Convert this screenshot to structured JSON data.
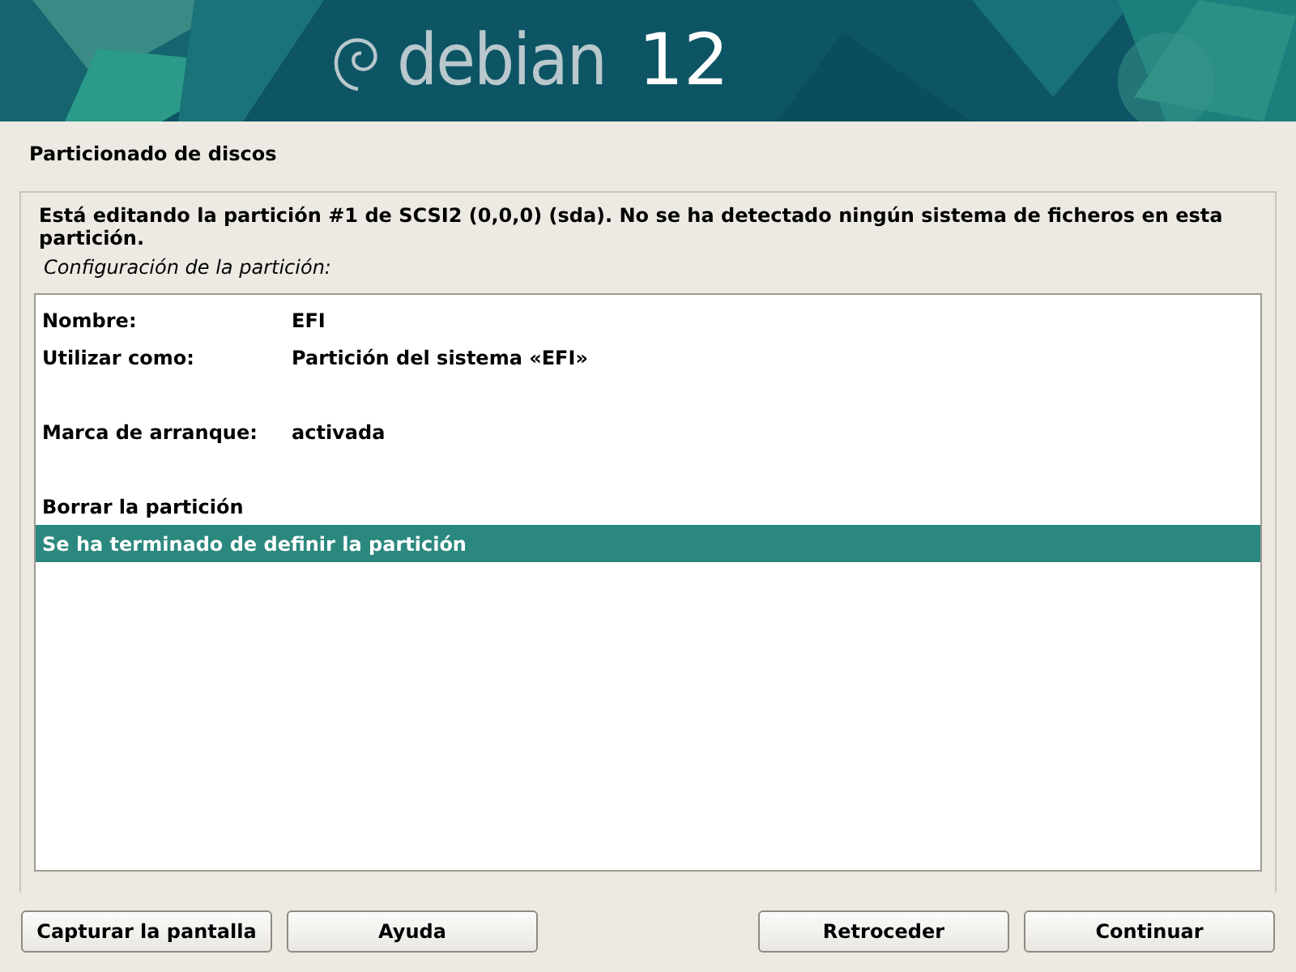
{
  "banner": {
    "logo_word": "debian",
    "logo_version": "12"
  },
  "title": "Particionado de discos",
  "description": "Está editando la partición #1 de SCSI2 (0,0,0) (sda). No se ha detectado ningún sistema de ficheros en esta partición.",
  "list_label": "Configuración de la partición:",
  "items": [
    {
      "kind": "setting",
      "label": "Nombre:",
      "value": "EFI",
      "selected": false
    },
    {
      "kind": "setting",
      "label": "Utilizar como:",
      "value": "Partición del sistema «EFI»",
      "selected": false
    },
    {
      "kind": "blank"
    },
    {
      "kind": "setting",
      "label": "Marca de arranque:",
      "value": "activada",
      "selected": false
    },
    {
      "kind": "blank"
    },
    {
      "kind": "action",
      "label": "Borrar la partición",
      "selected": false
    },
    {
      "kind": "action",
      "label": "Se ha terminado de definir la partición",
      "selected": true
    }
  ],
  "buttons_left": [
    "Capturar la pantalla",
    "Ayuda"
  ],
  "buttons_right": [
    "Retroceder",
    "Continuar"
  ]
}
